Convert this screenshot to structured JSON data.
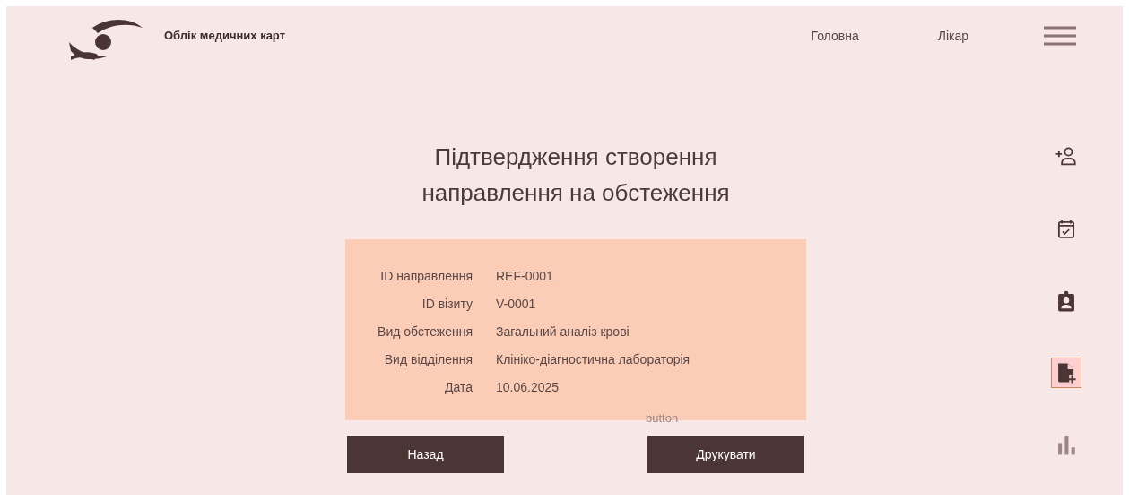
{
  "header": {
    "title": "Облік медичних карт",
    "nav": [
      {
        "label": "Головна"
      },
      {
        "label": "Лікар"
      }
    ]
  },
  "heading": "Підтвердження створення\nнаправлення на обстеження",
  "details": [
    {
      "label": "ID направлення",
      "value": "REF-0001"
    },
    {
      "label": "ID візиту",
      "value": "V-0001"
    },
    {
      "label": "Вид обстеження",
      "value": "Загальний аналіз крові"
    },
    {
      "label": "Вид відділення",
      "value": "Клініко-діагностична лабораторія"
    },
    {
      "label": "Дата",
      "value": "10.06.2025"
    }
  ],
  "ghost_label": "button",
  "buttons": [
    {
      "label": "Назад"
    },
    {
      "label": "Друкувати"
    }
  ],
  "side_tools": [
    {
      "kind": "add-user",
      "selected": false,
      "disabled": false
    },
    {
      "kind": "calendar",
      "selected": false,
      "disabled": false
    },
    {
      "kind": "badge",
      "selected": false,
      "disabled": false
    },
    {
      "kind": "file-add",
      "selected": true,
      "disabled": false
    },
    {
      "kind": "chart",
      "selected": false,
      "disabled": true
    }
  ]
}
